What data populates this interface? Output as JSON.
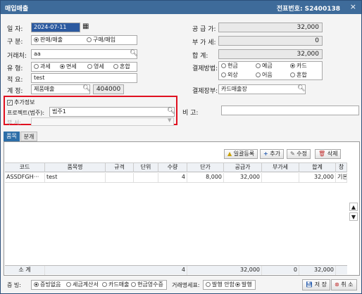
{
  "window": {
    "title": "매입매출",
    "slip_no": "전표번호: S2400138",
    "close": "×"
  },
  "form": {
    "date": {
      "label": "일   자:",
      "value": "2024-07-11"
    },
    "division": {
      "label": "구   분:",
      "options": [
        "판매/매출",
        "구매/매입"
      ],
      "selected": 0
    },
    "customer": {
      "label": "거래처:",
      "value": "aa"
    },
    "type": {
      "label": "유   형:",
      "options": [
        "과세",
        "면세",
        "영세",
        "혼합"
      ],
      "selected": 1
    },
    "summary": {
      "label": "적   요:",
      "value": "test"
    },
    "account": {
      "label": "계   정:",
      "value": "제품매출",
      "code": "404000"
    },
    "supply": {
      "label": "공 급 가:",
      "value": "32,000"
    },
    "vat": {
      "label": "부 가 세:",
      "value": "0"
    },
    "total": {
      "label": "합     계:",
      "value": "32,000"
    },
    "payment": {
      "label": "결제방법:",
      "options": [
        "현금",
        "예금",
        "카드",
        "외상",
        "어음",
        "혼합"
      ],
      "selected": 2
    },
    "pay_account": {
      "label": "결제장부:",
      "value": "카드매출장"
    },
    "extra": {
      "label": "추가정보",
      "checked": true
    },
    "project": {
      "label": "프로젝트(범주):",
      "value": "범주1"
    },
    "dept": {
      "label": "부   서:"
    },
    "memo": {
      "label": "비   고:",
      "value": ""
    }
  },
  "tabs": [
    "품목",
    "분개"
  ],
  "toolbar": {
    "bulk": "일괄등록",
    "add": "추가",
    "edit": "수정",
    "delete": "삭제"
  },
  "grid": {
    "columns": [
      "코드",
      "품목명",
      "규격",
      "단위",
      "수량",
      "단가",
      "공급가",
      "부가세",
      "합계",
      "창"
    ],
    "rows": [
      {
        "code": "ASSDFGH···",
        "name": "test",
        "spec": "",
        "unit": "",
        "qty": "4",
        "price": "8,000",
        "supply": "32,000",
        "vat": "",
        "total": "32,000",
        "wh": "기본"
      }
    ],
    "summary": {
      "label": "소 계",
      "qty": "4",
      "supply": "32,000",
      "vat": "0",
      "total": "32,000"
    }
  },
  "bottom": {
    "evidence_label": "증  빙:",
    "evidence_options": [
      "증빙없음",
      "세금계산서",
      "카드매출",
      "현금영수증"
    ],
    "evidence_selected": 0,
    "statement_label": "거래명세표:",
    "statement_options": [
      "발행 안함",
      "발행"
    ],
    "statement_selected": 1,
    "save": "저 장",
    "cancel": "취 소"
  },
  "colors": {
    "title_bar": "#3e6b9a",
    "highlight_box": "#e01020",
    "active_tab": "#2d6ea8"
  }
}
